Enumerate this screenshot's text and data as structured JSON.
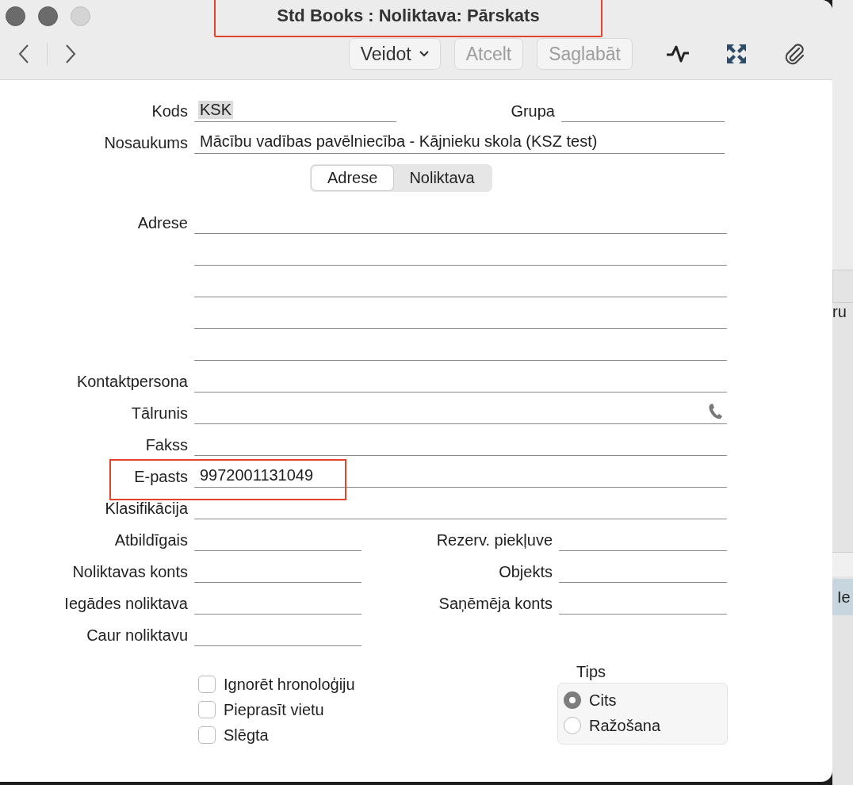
{
  "window": {
    "title": "Std Books : Noliktava: Pārskats",
    "title_highlighted": true
  },
  "toolbar": {
    "buttons": [
      {
        "label": "Veidot",
        "kind": "menu",
        "disabled": false
      },
      {
        "label": "Atcelt",
        "kind": "push",
        "disabled": true
      },
      {
        "label": "Saglabāt",
        "kind": "push",
        "disabled": true
      }
    ]
  },
  "header": {
    "code": {
      "label": "Kods",
      "value": "KSK",
      "selected": true
    },
    "group": {
      "label": "Grupa"
    },
    "name": {
      "label": "Nosaukums",
      "value": "Mācību vadības pavēlniecība - Kājnieku skola (KSZ test)"
    }
  },
  "tabs": [
    {
      "label": "Adrese",
      "selected": true
    },
    {
      "label": "Noliktava",
      "selected": false
    }
  ],
  "address": {
    "label": "Adrese"
  },
  "contact_fields": [
    {
      "label": "Kontaktpersona",
      "kind": "text",
      "highlighted": false
    },
    {
      "label": "Tālrunis",
      "kind": "phone",
      "highlighted": false
    },
    {
      "label": "Fakss",
      "kind": "text",
      "highlighted": false
    },
    {
      "label": "E-pasts",
      "kind": "text",
      "value": "9972001131049",
      "highlighted": true
    },
    {
      "label": "Klasifikācija",
      "kind": "text",
      "highlighted": false
    }
  ],
  "pair_rows": [
    {
      "left": "Atbildīgais",
      "right": "Rezerv. piekļuve"
    },
    {
      "left": "Noliktavas konts",
      "right": "Objekts"
    },
    {
      "left": "Iegādes noliktava",
      "right": "Saņēmēja konts"
    },
    {
      "left": "Caur noliktavu"
    }
  ],
  "checkboxes": [
    {
      "label": "Ignorēt hronoloģiju",
      "checked": false
    },
    {
      "label": "Pieprasīt vietu",
      "checked": false
    },
    {
      "label": "Slēgta",
      "checked": false
    }
  ],
  "type_group": {
    "title": "Tips",
    "options": [
      {
        "label": "Cits",
        "selected": true
      },
      {
        "label": "Ražošana",
        "selected": false
      }
    ]
  },
  "background_window": {
    "texts": [
      "ru",
      "Ie"
    ]
  }
}
